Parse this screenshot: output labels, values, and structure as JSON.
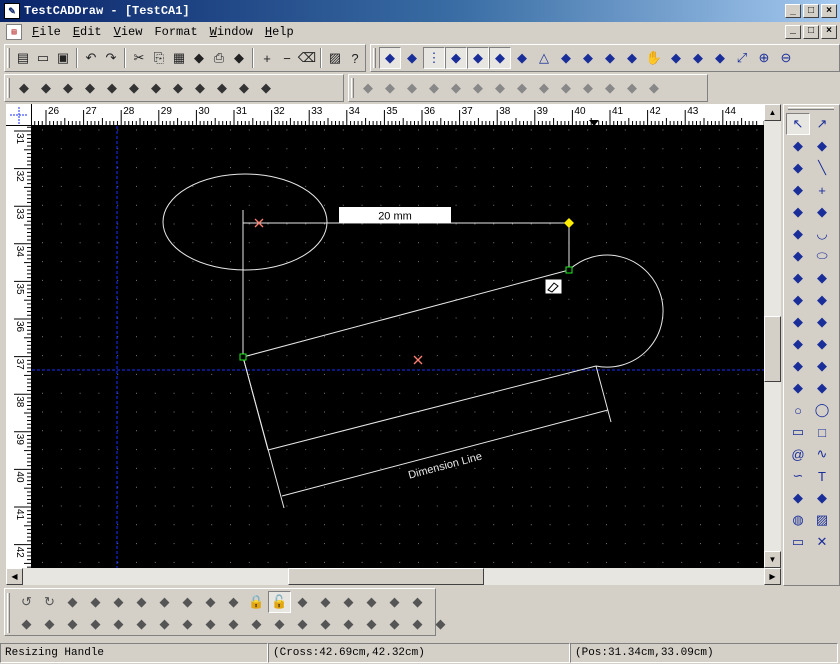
{
  "window": {
    "title": "TestCADDraw - [TestCA1]",
    "app_icon": "cad-app-icon",
    "controls": {
      "minimize": "_",
      "maximize": "□",
      "close": "×"
    }
  },
  "menu": {
    "items": [
      {
        "label": "File",
        "hotkey": "F"
      },
      {
        "label": "Edit",
        "hotkey": "E"
      },
      {
        "label": "View",
        "hotkey": "V"
      },
      {
        "label": "Format",
        "hotkey": ""
      },
      {
        "label": "Window",
        "hotkey": "W"
      },
      {
        "label": "Help",
        "hotkey": "H"
      }
    ]
  },
  "toolbars": {
    "standard": [
      "new-document-icon",
      "open-folder-icon",
      "save-icon",
      "undo-icon",
      "redo-icon",
      "cut-icon",
      "copy-icon",
      "paste-icon",
      "print-preview-icon",
      "print-icon",
      "properties-icon",
      "zoom-in-plus-icon",
      "zoom-out-minus-icon",
      "eraser-icon",
      "image-icon",
      "help-icon"
    ],
    "view": [
      "draw-mode-icon",
      "select-mode-icon",
      "grid-icon",
      "axis-icon",
      "snap-grid-icon",
      "snap-point-icon",
      "bounding-box-icon",
      "triangle-icon",
      "snap-corner-icon",
      "frame-icon",
      "center-icon",
      "zoom-window-icon",
      "pan-hand-icon",
      "layers-icon",
      "layer-properties-icon",
      "layer-stack-icon",
      "fit-icon",
      "zoom-in-icon",
      "zoom-out-icon"
    ],
    "dimension": [
      "dim-linear-icon",
      "dim-aligned-icon",
      "dim-angular-icon",
      "dim-radial-icon",
      "dim-diameter-icon",
      "dim-ordinate-icon",
      "dim-baseline-icon",
      "dim-continue-icon",
      "dim-leader-icon",
      "dim-center-icon",
      "dim-tolerance-icon",
      "dim-edit-icon"
    ],
    "modify": [
      "union-icon",
      "subtract-icon",
      "intersect-icon",
      "combine-icon",
      "break-icon",
      "trim-icon",
      "mirror-h-icon",
      "mirror-v-icon",
      "scale-icon",
      "rotate-icon",
      "align-h-icon",
      "align-v-icon",
      "flip-icon",
      "stretch-icon"
    ],
    "drawing": [
      "pointer-icon",
      "pointer-plus-icon",
      "lasso-icon",
      "node-edit-icon",
      "polyline-icon",
      "line-icon",
      "arrow-line-icon",
      "cross-icon",
      "spline-icon",
      "curve-edit-icon",
      "bezier-icon",
      "arc-icon",
      "circle-arc-icon",
      "ellipse-icon",
      "dim-h-icon",
      "dim-v-icon",
      "dim-angle-icon",
      "dim-radius-icon",
      "callout-rect-icon",
      "callout-round-icon",
      "cloud-icon",
      "cloud-callout-icon",
      "freehand-icon",
      "polygon-edit-icon",
      "shape-icon",
      "shape-edit-icon",
      "circle-icon",
      "circle-filled-icon",
      "rectangle-icon",
      "square-icon",
      "spiral-icon",
      "wave-icon",
      "curve-icon",
      "text-icon",
      "flag-text-icon",
      "text-style-icon",
      "globe-icon",
      "picture-icon",
      "window-icon",
      "cancel-icon"
    ],
    "arrange": [
      "rotate-left-icon",
      "rotate-edit-icon",
      "rotate-shape-icon",
      "align-center-icon",
      "align-icon",
      "distribute-icon",
      "flip-horizontal-icon",
      "flip-vertical-icon",
      "group-icon",
      "ungroup-icon",
      "lock-icon",
      "unlock-icon",
      "align-top-icon",
      "align-middle-icon",
      "align-bottom-icon",
      "align-right-icon",
      "space-h-icon",
      "space-v-icon",
      "align-left-edge-icon",
      "align-h-center-icon",
      "align-right-edge-icon",
      "align-top-edge-icon",
      "align-v-center-icon",
      "align-bottom-edge-icon",
      "size-width-icon",
      "size-height-icon",
      "bring-front-icon",
      "send-back-icon",
      "bring-forward-icon",
      "send-backward-icon",
      "order-icon",
      "order-2-icon",
      "more-icon",
      "center-page-icon",
      "snap-icon",
      "fit-page-icon",
      "page-icon"
    ]
  },
  "rulers": {
    "horizontal_labels": [
      "26",
      "27",
      "28",
      "29",
      "30",
      "31",
      "32",
      "33",
      "34",
      "35",
      "36",
      "37",
      "38",
      "39",
      "40",
      "41",
      "42",
      "43",
      "44"
    ],
    "vertical_labels": [
      "31",
      "32",
      "33",
      "34",
      "35",
      "36",
      "37",
      "38",
      "39",
      "40",
      "41",
      "42"
    ]
  },
  "drawing": {
    "dimension_value": "20 mm",
    "dimension_label": "Dimension Line"
  },
  "status": {
    "message": "Resizing Handle",
    "cross": "(Cross:42.69cm,42.32cm)",
    "pos": "(Pos:31.34cm,33.09cm)"
  },
  "colors": {
    "canvas_bg": "#000000",
    "grid_dot": "#7a7a7a",
    "crosshair": "#1a2eff",
    "shape_stroke": "#e8e8e8",
    "marker_x": "#ff8070",
    "handle_green": "#22ee22",
    "handle_yellow": "#ffee00",
    "chrome": "#d4d0c8",
    "title_start": "#0a246a"
  }
}
